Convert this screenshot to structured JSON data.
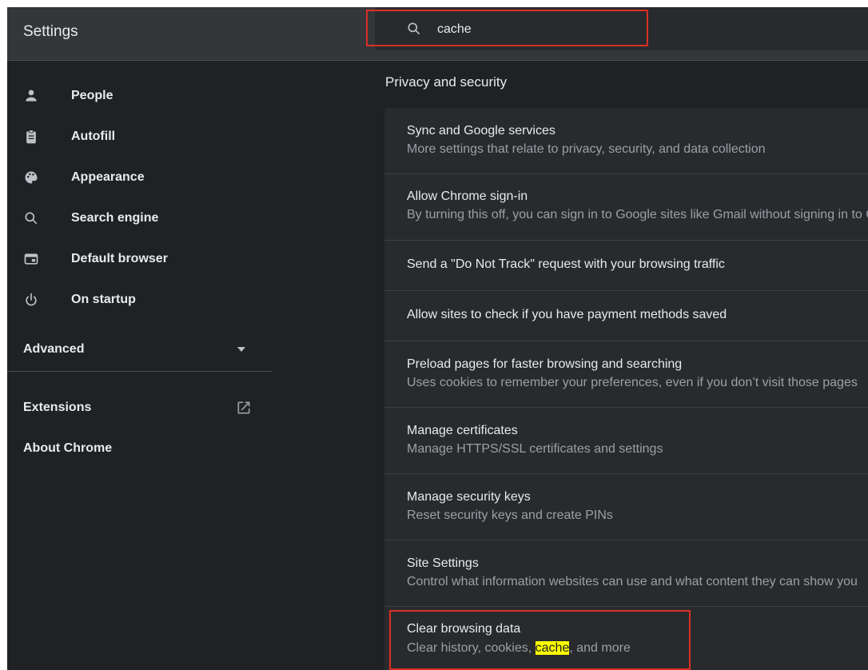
{
  "header": {
    "title": "Settings"
  },
  "search": {
    "value": "cache",
    "icon": "search-icon"
  },
  "sidebar": {
    "items": [
      {
        "label": "People",
        "icon": "person-icon"
      },
      {
        "label": "Autofill",
        "icon": "clipboard-icon"
      },
      {
        "label": "Appearance",
        "icon": "palette-icon"
      },
      {
        "label": "Search engine",
        "icon": "search-icon"
      },
      {
        "label": "Default browser",
        "icon": "browser-icon"
      },
      {
        "label": "On startup",
        "icon": "power-icon"
      }
    ],
    "advanced": {
      "label": "Advanced"
    },
    "extensions": {
      "label": "Extensions"
    },
    "about": {
      "label": "About Chrome"
    }
  },
  "main": {
    "section_title": "Privacy and security",
    "rows": [
      {
        "title": "Sync and Google services",
        "subtitle": "More settings that relate to privacy, security, and data collection"
      },
      {
        "title": "Allow Chrome sign-in",
        "subtitle": "By turning this off, you can sign in to Google sites like Gmail without signing in to Chrome"
      },
      {
        "title": "Send a \"Do Not Track\" request with your browsing traffic"
      },
      {
        "title": "Allow sites to check if you have payment methods saved"
      },
      {
        "title": "Preload pages for faster browsing and searching",
        "subtitle": "Uses cookies to remember your preferences, even if you don’t visit those pages"
      },
      {
        "title": "Manage certificates",
        "subtitle": "Manage HTTPS/SSL certificates and settings"
      },
      {
        "title": "Manage security keys",
        "subtitle": "Reset security keys and create PINs"
      },
      {
        "title": "Site Settings",
        "subtitle": "Control what information websites can use and what content they can show you"
      },
      {
        "title": "Clear browsing data",
        "subtitle_before": "Clear history, cookies, ",
        "subtitle_match": "cache",
        "subtitle_after": ", and more"
      }
    ]
  },
  "colors": {
    "background": "#202124",
    "card": "#292a2d",
    "text": "#e8eaed",
    "secondary_text": "#9aa0a6",
    "annotation_red": "#d93025",
    "match_highlight": "#ffff00"
  }
}
